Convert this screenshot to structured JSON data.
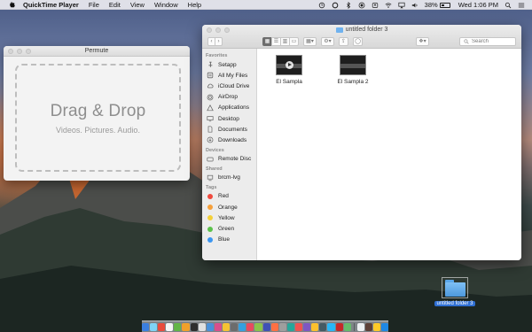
{
  "menubar": {
    "app_name": "QuickTime Player",
    "menus": [
      "File",
      "Edit",
      "View",
      "Window",
      "Help"
    ],
    "battery_percent": "38%",
    "clock": "Wed 1:06 PM"
  },
  "permute": {
    "title": "Permute",
    "drop_title": "Drag & Drop",
    "drop_subtitle": "Videos. Pictures. Audio."
  },
  "finder": {
    "title": "untitled folder 3",
    "search_placeholder": "Search",
    "sidebar": {
      "favorites_header": "Favorites",
      "favorites": [
        {
          "label": "Setapp",
          "icon": "setapp-icon"
        },
        {
          "label": "All My Files",
          "icon": "all-files-icon"
        },
        {
          "label": "iCloud Drive",
          "icon": "cloud-icon"
        },
        {
          "label": "AirDrop",
          "icon": "airdrop-icon"
        },
        {
          "label": "Applications",
          "icon": "applications-icon"
        },
        {
          "label": "Desktop",
          "icon": "desktop-icon"
        },
        {
          "label": "Documents",
          "icon": "documents-icon"
        },
        {
          "label": "Downloads",
          "icon": "downloads-icon"
        }
      ],
      "devices_header": "Devices",
      "devices": [
        {
          "label": "Remote Disc",
          "icon": "disc-icon"
        }
      ],
      "shared_header": "Shared",
      "shared": [
        {
          "label": "brcm-lvg",
          "icon": "network-computer-icon"
        }
      ],
      "tags_header": "Tags",
      "tags": [
        {
          "label": "Red",
          "color": "#f04a3e"
        },
        {
          "label": "Orange",
          "color": "#f6a03b"
        },
        {
          "label": "Yellow",
          "color": "#f4d03a"
        },
        {
          "label": "Green",
          "color": "#5bc24b"
        },
        {
          "label": "Blue",
          "color": "#3b96f1"
        }
      ]
    },
    "files": [
      {
        "name": "El Sampla"
      },
      {
        "name": "El Sampla 2"
      }
    ]
  },
  "desktop": {
    "folder_label": "untitled folder 3"
  },
  "dock": {
    "colors": [
      "#3b7fe0",
      "#7fd3f5",
      "#e94b3c",
      "#f5f5f5",
      "#63b547",
      "#f0a02b",
      "#2e2e2e",
      "#e0e0e0",
      "#4a90d9",
      "#d94f8c",
      "#f5c332",
      "#6c6c6c",
      "#35a0e0",
      "#e84a5f",
      "#8bc34a",
      "#3f51b5",
      "#ff7043",
      "#9e9e9e",
      "#26a69a",
      "#ef5350",
      "#7e57c2",
      "#fbc02d",
      "#455a64",
      "#29b6f6",
      "#c62828",
      "#66bb6a",
      "#eceff1",
      "#5d4037",
      "#ffca28",
      "#1e88e5"
    ]
  }
}
